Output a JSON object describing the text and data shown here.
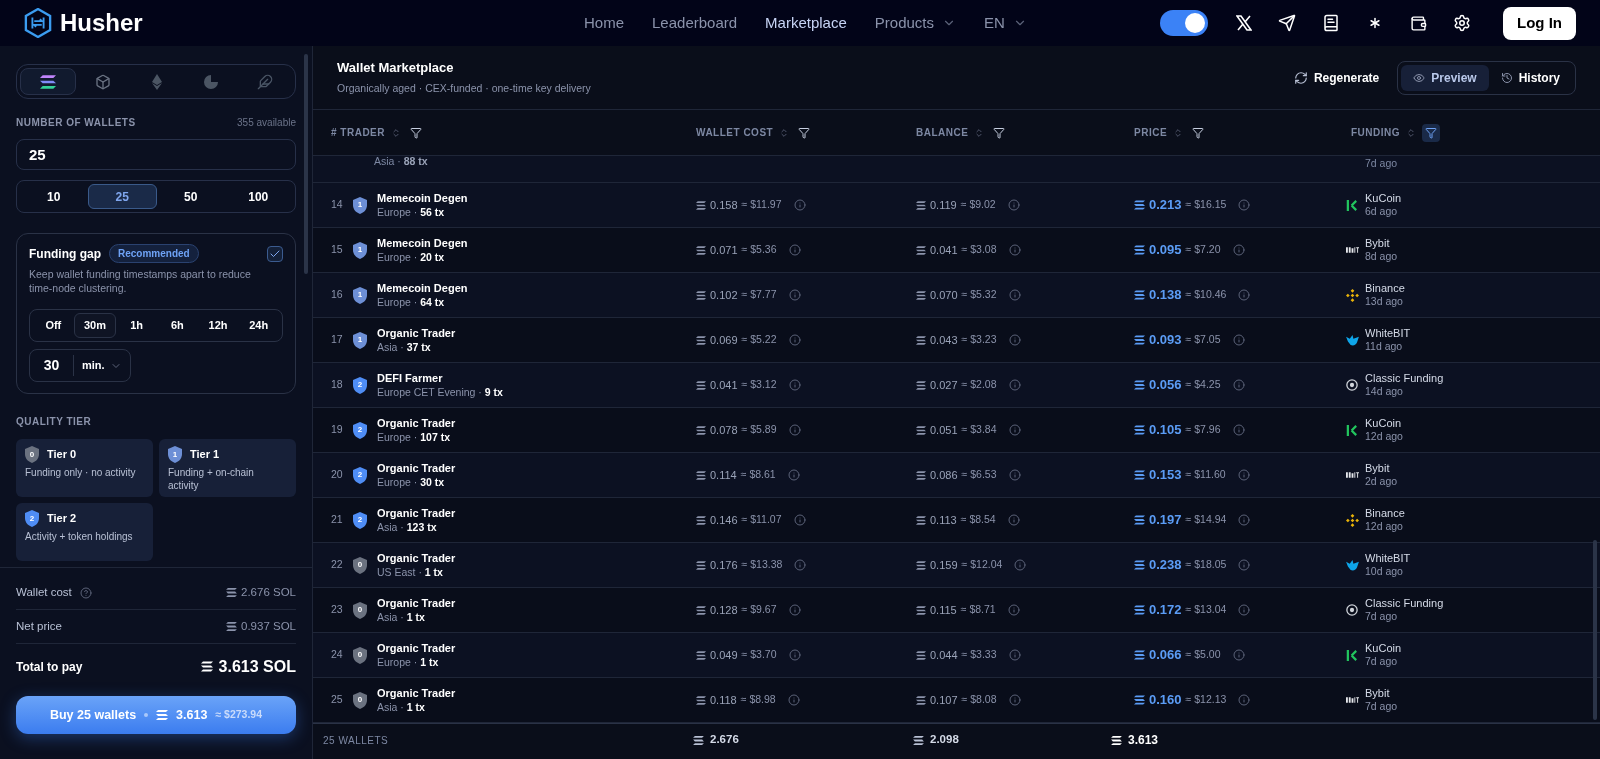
{
  "nav": {
    "brand": "Husher",
    "links": [
      {
        "label": "Home",
        "selected": false,
        "dropdown": false
      },
      {
        "label": "Leaderboard",
        "selected": false,
        "dropdown": false
      },
      {
        "label": "Marketplace",
        "selected": true,
        "dropdown": false
      },
      {
        "label": "Products",
        "selected": false,
        "dropdown": true
      },
      {
        "label": "EN",
        "selected": false,
        "dropdown": true
      }
    ],
    "toggle_on": true,
    "login": "Log In"
  },
  "sidebar": {
    "chains": [
      {
        "kind": "solana",
        "selected": true
      },
      {
        "kind": "cube",
        "selected": false
      },
      {
        "kind": "ethereum",
        "selected": false
      },
      {
        "kind": "c",
        "selected": false
      },
      {
        "kind": "feather",
        "selected": false
      }
    ],
    "wallets_label": "NUMBER OF WALLETS",
    "available": "355 available",
    "wallets_value": "25",
    "presets": [
      {
        "label": "10",
        "selected": false
      },
      {
        "label": "25",
        "selected": true
      },
      {
        "label": "50",
        "selected": false
      },
      {
        "label": "100",
        "selected": false
      }
    ],
    "funding_gap": {
      "title": "Funding gap",
      "badge": "Recommended",
      "checked": true,
      "description": "Keep wallet funding timestamps apart to reduce time-node clustering.",
      "intervals": [
        {
          "label": "Off",
          "selected": false
        },
        {
          "label": "30m",
          "selected": true
        },
        {
          "label": "1h",
          "selected": false
        },
        {
          "label": "6h",
          "selected": false
        },
        {
          "label": "12h",
          "selected": false
        },
        {
          "label": "24h",
          "selected": false
        }
      ],
      "amount": "30",
      "unit": "min."
    },
    "tier_label": "QUALITY TIER",
    "tiers": [
      {
        "badge": "0",
        "title": "Tier 0",
        "description": "Funding only · no activity"
      },
      {
        "badge": "1",
        "title": "Tier 1",
        "description": "Funding + on-chain activity"
      },
      {
        "badge": "2",
        "title": "Tier 2",
        "description": "Activity + token holdings"
      }
    ],
    "summary": [
      {
        "label": "Wallet cost",
        "help": true,
        "value": "2.676",
        "unit": "SOL"
      },
      {
        "label": "Net price",
        "help": false,
        "value": "0.937",
        "unit": "SOL"
      }
    ],
    "total": {
      "label": "Total to pay",
      "value": "3.613",
      "unit": "SOL"
    },
    "buy": {
      "label": "Buy 25 wallets",
      "amount": "3.613",
      "usd": "≈ $273.94"
    }
  },
  "main": {
    "title": "Wallet Marketplace",
    "subtitle": "Organically aged · CEX-funded · one-time key delivery",
    "regenerate": "Regenerate",
    "views": [
      {
        "label": "Preview",
        "kind": "eye",
        "selected": true
      },
      {
        "label": "History",
        "kind": "history",
        "selected": false
      }
    ]
  },
  "table": {
    "columns": [
      {
        "label": "# TRADER",
        "filter_active": false
      },
      {
        "label": "WALLET COST",
        "filter_active": false
      },
      {
        "label": "BALANCE",
        "filter_active": false
      },
      {
        "label": "PRICE",
        "filter_active": false
      },
      {
        "label": "FUNDING",
        "filter_active": true
      }
    ],
    "partial_row": {
      "detail": "Asia · **88 tx**",
      "funding_time": "7d ago"
    },
    "rows": [
      {
        "n": "14",
        "tier": "1",
        "name": "Memecoin Degen",
        "detail": "Europe · **56 tx**",
        "cost": "0.158",
        "cost_usd": "≈ $11.97",
        "balance": "0.119",
        "balance_usd": "≈ $9.02",
        "price": "0.213",
        "price_usd": "≈ $16.15",
        "funding": {
          "kind": "kucoin",
          "name": "KuCoin",
          "time": "6d ago"
        }
      },
      {
        "n": "15",
        "tier": "1",
        "name": "Memecoin Degen",
        "detail": "Europe · **20 tx**",
        "cost": "0.071",
        "cost_usd": "≈ $5.36",
        "balance": "0.041",
        "balance_usd": "≈ $3.08",
        "price": "0.095",
        "price_usd": "≈ $7.20",
        "funding": {
          "kind": "bybit",
          "name": "Bybit",
          "time": "8d ago"
        }
      },
      {
        "n": "16",
        "tier": "1",
        "name": "Memecoin Degen",
        "detail": "Europe · **64 tx**",
        "cost": "0.102",
        "cost_usd": "≈ $7.77",
        "balance": "0.070",
        "balance_usd": "≈ $5.32",
        "price": "0.138",
        "price_usd": "≈ $10.46",
        "funding": {
          "kind": "binance",
          "name": "Binance",
          "time": "13d ago"
        }
      },
      {
        "n": "17",
        "tier": "1",
        "name": "Organic Trader",
        "detail": "Asia · **37 tx**",
        "cost": "0.069",
        "cost_usd": "≈ $5.22",
        "balance": "0.043",
        "balance_usd": "≈ $3.23",
        "price": "0.093",
        "price_usd": "≈ $7.05",
        "funding": {
          "kind": "whitebit",
          "name": "WhiteBIT",
          "time": "11d ago"
        }
      },
      {
        "n": "18",
        "tier": "2",
        "name": "DEFI Farmer",
        "detail": "Europe CET Evening · **9 tx**",
        "cost": "0.041",
        "cost_usd": "≈ $3.12",
        "balance": "0.027",
        "balance_usd": "≈ $2.08",
        "price": "0.056",
        "price_usd": "≈ $4.25",
        "funding": {
          "kind": "classic",
          "name": "Classic Funding",
          "time": "14d ago"
        }
      },
      {
        "n": "19",
        "tier": "2",
        "name": "Organic Trader",
        "detail": "Europe · **107 tx**",
        "cost": "0.078",
        "cost_usd": "≈ $5.89",
        "balance": "0.051",
        "balance_usd": "≈ $3.84",
        "price": "0.105",
        "price_usd": "≈ $7.96",
        "funding": {
          "kind": "kucoin",
          "name": "KuCoin",
          "time": "12d ago"
        }
      },
      {
        "n": "20",
        "tier": "2",
        "name": "Organic Trader",
        "detail": "Europe · **30 tx**",
        "cost": "0.114",
        "cost_usd": "≈ $8.61",
        "balance": "0.086",
        "balance_usd": "≈ $6.53",
        "price": "0.153",
        "price_usd": "≈ $11.60",
        "funding": {
          "kind": "bybit",
          "name": "Bybit",
          "time": "2d ago"
        }
      },
      {
        "n": "21",
        "tier": "2",
        "name": "Organic Trader",
        "detail": "Asia · **123 tx**",
        "cost": "0.146",
        "cost_usd": "≈ $11.07",
        "balance": "0.113",
        "balance_usd": "≈ $8.54",
        "price": "0.197",
        "price_usd": "≈ $14.94",
        "funding": {
          "kind": "binance",
          "name": "Binance",
          "time": "12d ago"
        }
      },
      {
        "n": "22",
        "tier": "0",
        "name": "Organic Trader",
        "detail": "US East · **1 tx**",
        "cost": "0.176",
        "cost_usd": "≈ $13.38",
        "balance": "0.159",
        "balance_usd": "≈ $12.04",
        "price": "0.238",
        "price_usd": "≈ $18.05",
        "funding": {
          "kind": "whitebit",
          "name": "WhiteBIT",
          "time": "10d ago"
        }
      },
      {
        "n": "23",
        "tier": "0",
        "name": "Organic Trader",
        "detail": "Asia · **1 tx**",
        "cost": "0.128",
        "cost_usd": "≈ $9.67",
        "balance": "0.115",
        "balance_usd": "≈ $8.71",
        "price": "0.172",
        "price_usd": "≈ $13.04",
        "funding": {
          "kind": "classic",
          "name": "Classic Funding",
          "time": "7d ago"
        }
      },
      {
        "n": "24",
        "tier": "0",
        "name": "Organic Trader",
        "detail": "Europe · **1 tx**",
        "cost": "0.049",
        "cost_usd": "≈ $3.70",
        "balance": "0.044",
        "balance_usd": "≈ $3.33",
        "price": "0.066",
        "price_usd": "≈ $5.00",
        "funding": {
          "kind": "kucoin",
          "name": "KuCoin",
          "time": "7d ago"
        }
      },
      {
        "n": "25",
        "tier": "0",
        "name": "Organic Trader",
        "detail": "Asia · **1 tx**",
        "cost": "0.118",
        "cost_usd": "≈ $8.98",
        "balance": "0.107",
        "balance_usd": "≈ $8.08",
        "price": "0.160",
        "price_usd": "≈ $12.13",
        "funding": {
          "kind": "bybit",
          "name": "Bybit",
          "time": "7d ago"
        }
      }
    ],
    "footer": {
      "count": "25 WALLETS",
      "cost": "2.676",
      "balance": "2.098",
      "price": "3.613"
    }
  }
}
